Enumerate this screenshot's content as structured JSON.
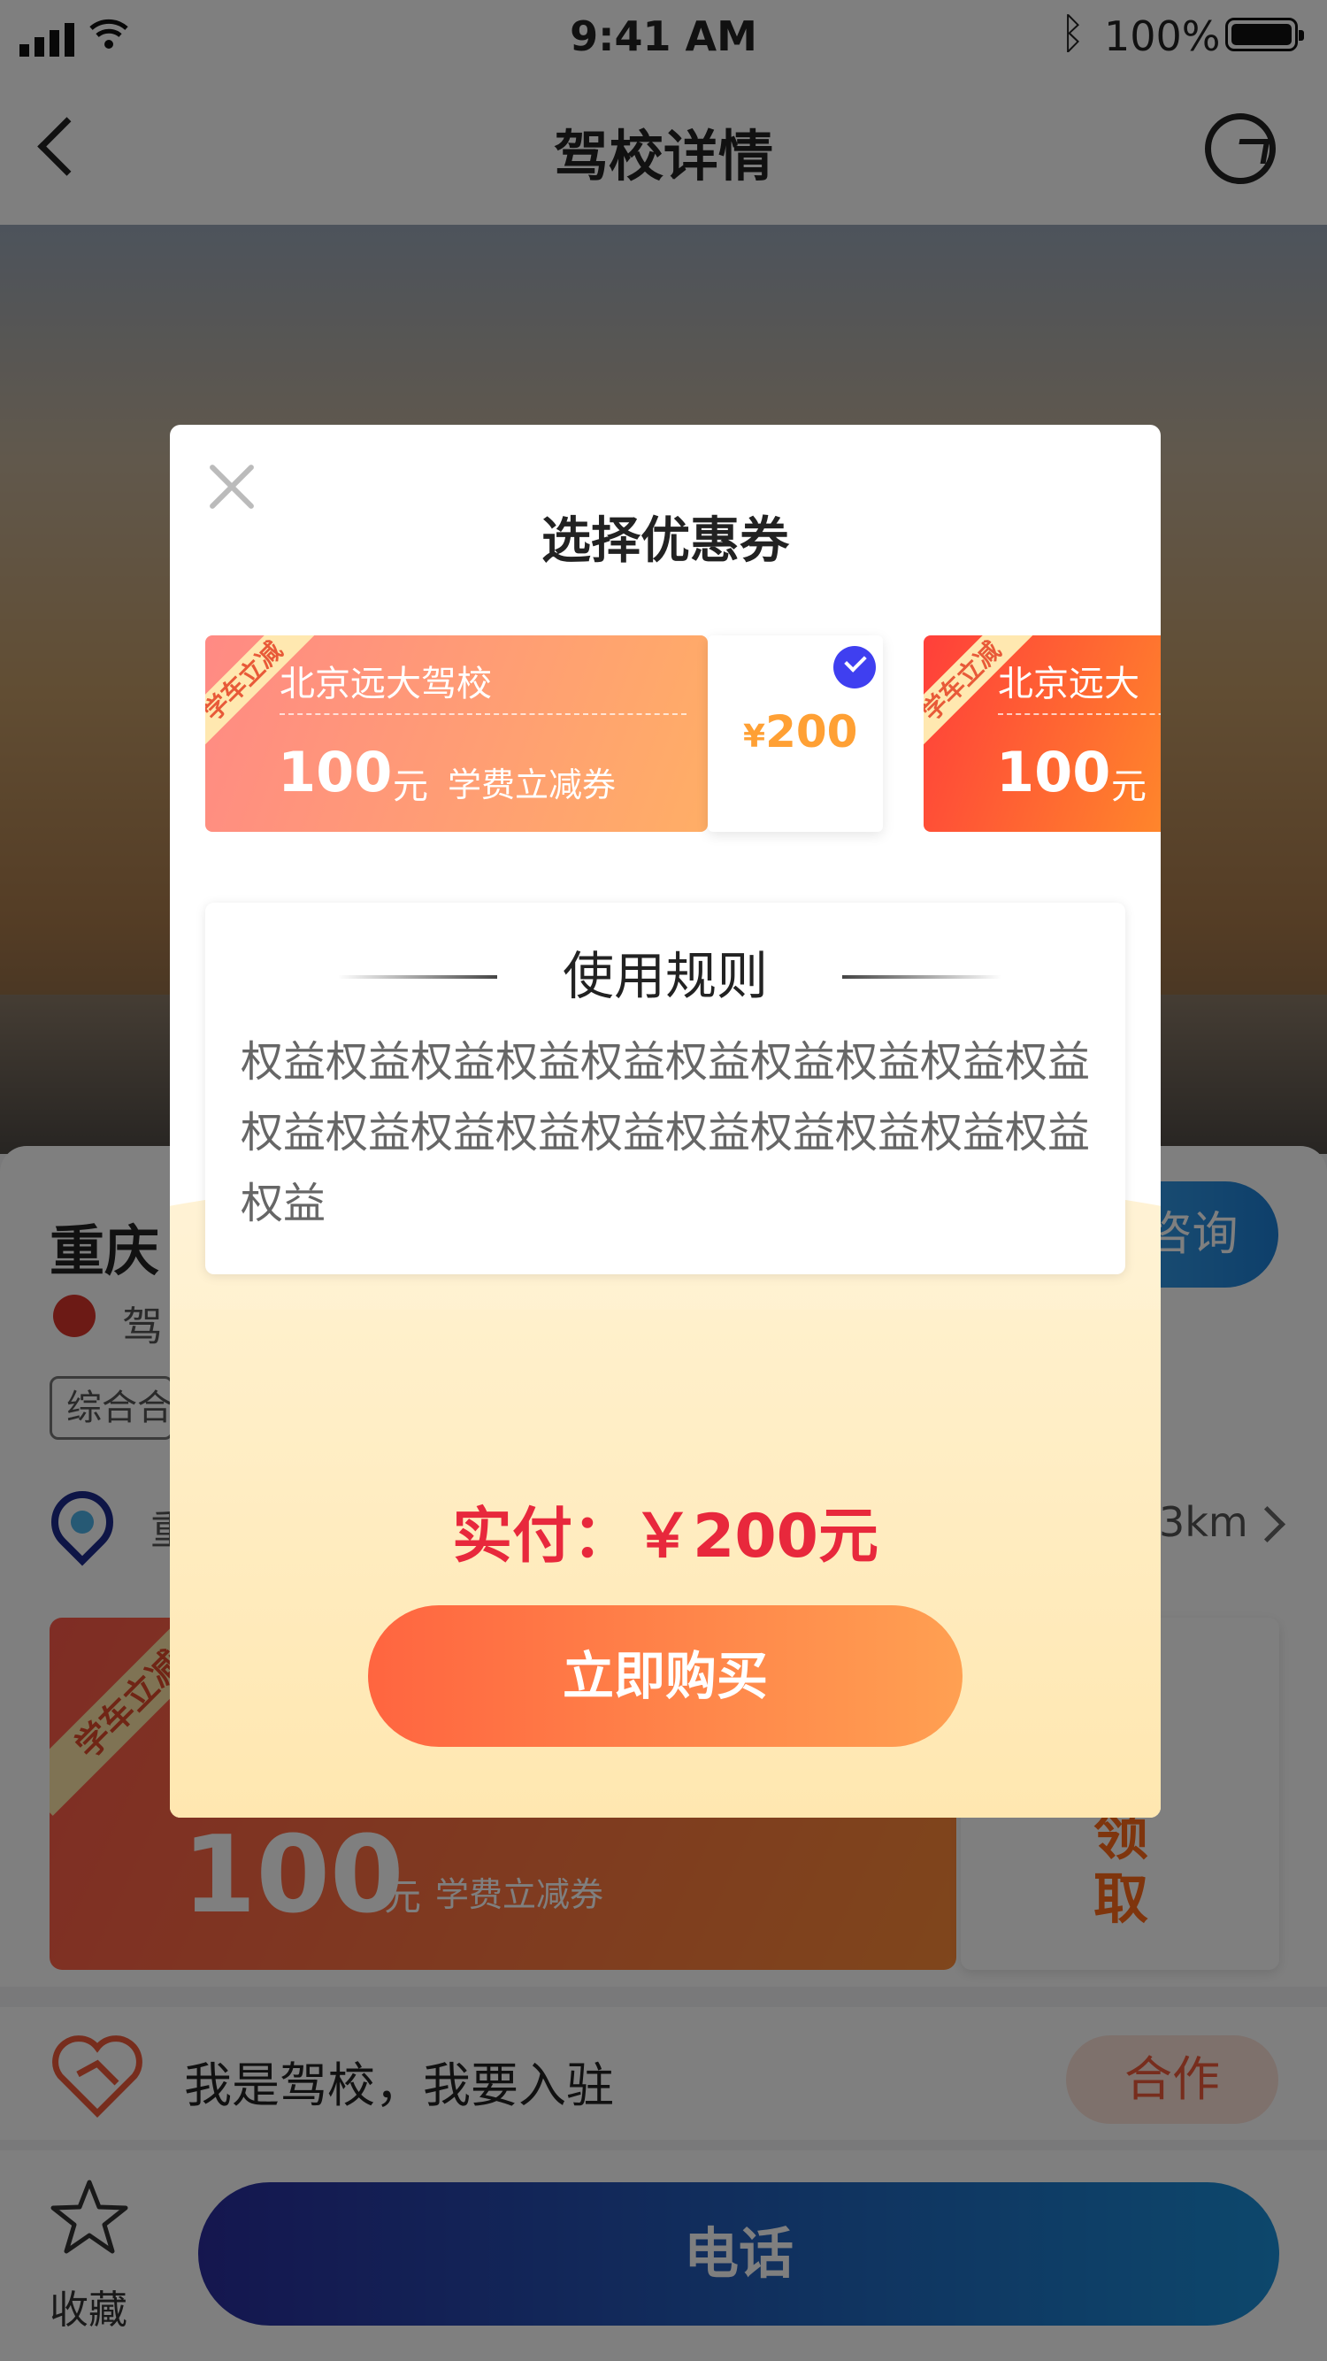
{
  "status_bar": {
    "time": "9:41 AM",
    "battery": "100%"
  },
  "nav": {
    "title": "驾校详情"
  },
  "school": {
    "name": "重庆",
    "consult_label": "咨询",
    "subtag": "驾",
    "pill": "综合合",
    "address": "重",
    "distance": "3km"
  },
  "big_coupon": {
    "ribbon": "学车立减",
    "amount": "100",
    "unit": "元",
    "desc": "学费立减券",
    "action": "领取"
  },
  "coop": {
    "text": "我是驾校，我要入驻",
    "button": "合作"
  },
  "bottom": {
    "favorite": "收藏",
    "call": "电话"
  },
  "modal": {
    "title": "选择优惠券",
    "coupons": [
      {
        "ribbon": "学车立减",
        "name": "北京远大驾校",
        "amount": "100",
        "unit": "元",
        "desc": "学费立减券",
        "currency": "¥",
        "price": "200",
        "selected": true
      },
      {
        "ribbon": "学车立减",
        "name": "北京远大",
        "amount": "100",
        "unit": "元"
      }
    ],
    "rules_title": "使用规则",
    "rules_text": "权益权益权益权益权益权益权益权益权益权益权益权益权益权益权益权益权益权益权益权益权益",
    "pay_text": "实付：￥200元",
    "buy_label": "立即购买"
  }
}
